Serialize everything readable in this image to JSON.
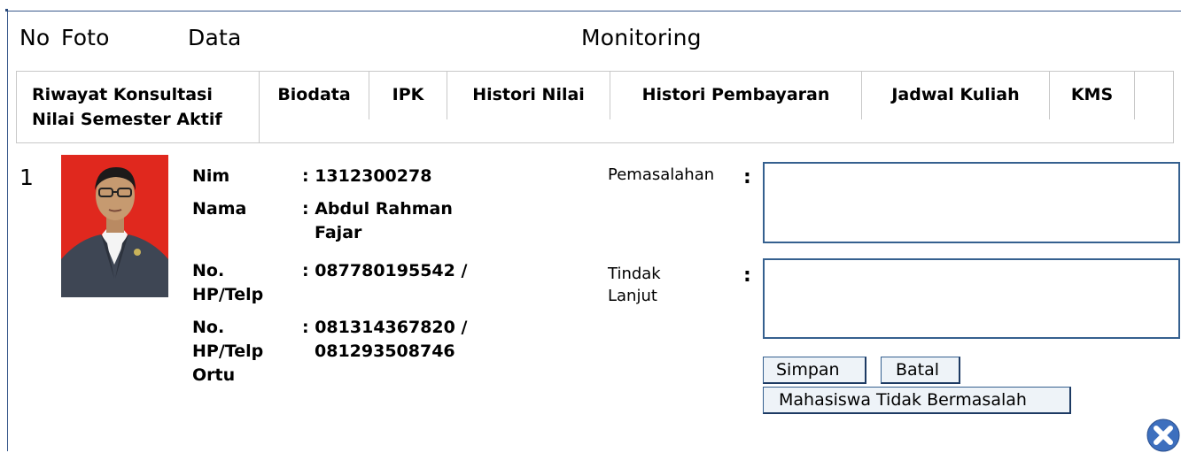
{
  "table_header": {
    "no": "No",
    "foto": "Foto",
    "data": "Data",
    "monitoring": "Monitoring"
  },
  "tabs": {
    "active_line1": "Riwayat Konsultasi",
    "active_line2": "Nilai Semester Aktif",
    "items": [
      "Biodata",
      "IPK",
      "Histori Nilai",
      "Histori Pembayaran",
      "Jadwal Kuliah",
      "KMS"
    ]
  },
  "row": {
    "no": "1",
    "nim_label": "Nim",
    "nim_value": ": 1312300278",
    "nama_label": "Nama",
    "nama_value_line1": ": Abdul Rahman",
    "nama_value_line2": "Fajar",
    "hp_label_line1": "No.",
    "hp_label_line2": "HP/Telp",
    "hp_value": ": 087780195542 /",
    "hp_ortu_label_line1": "No.",
    "hp_ortu_label_line2": "HP/Telp",
    "hp_ortu_label_line3": "Ortu",
    "hp_ortu_value_line1": ": 081314367820 /",
    "hp_ortu_value_line2": "081293508746"
  },
  "monitoring": {
    "pemasalahan_label": "Pemasalahan",
    "pemasalahan_value": "",
    "tindak_label_line1": "Tindak",
    "tindak_label_line2": "Lanjut",
    "tindak_value": "",
    "colon": ":",
    "simpan_label": "Simpan",
    "batal_label": "Batal",
    "tidak_bermasalah_label": "Mahasiswa Tidak Bermasalah"
  },
  "colors": {
    "border": "#35608f",
    "close_icon": "#3d6fbe",
    "photo_bg": "#e0281e"
  },
  "icons": {
    "close": "close-icon"
  }
}
